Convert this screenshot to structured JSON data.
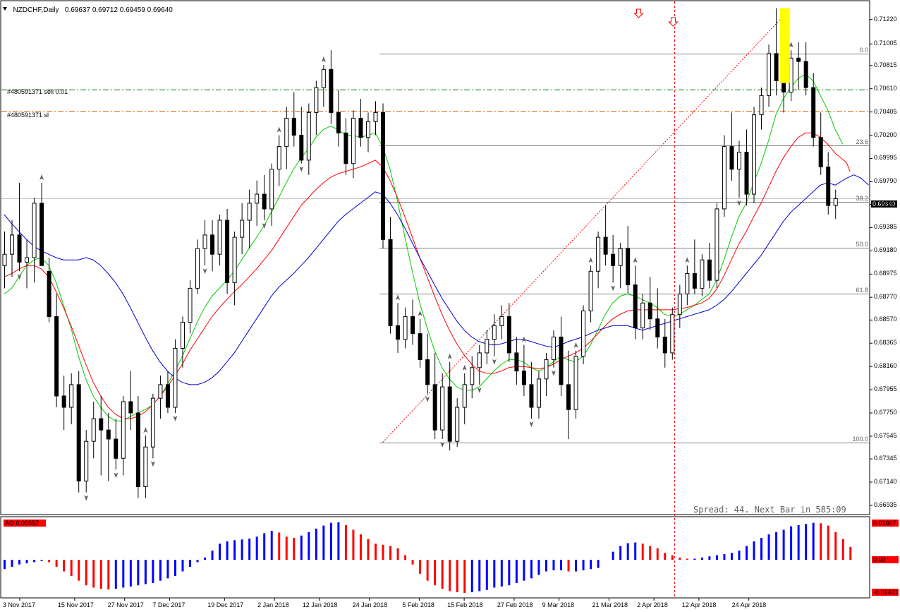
{
  "header": {
    "symbol": "NZDCHF,Daily",
    "ohlc": "0.69637 0.69712 0.69459 0.69640"
  },
  "orders": {
    "sell_label": "#480591371 sell 0.01",
    "sl_label": "#480591371 sl"
  },
  "spread_text": "Spread: 44. Next Bar in 585:09",
  "indicator": {
    "name": "AO 0.00557",
    "max_label": "0.01607",
    "zero_label": "0.00",
    "min_label": "-0.01431"
  },
  "price_axis": [
    "0.71220",
    "0.71005",
    "0.70815",
    "0.70610",
    "0.70405",
    "0.70200",
    "0.69995",
    "0.69790",
    "0.69590",
    "0.69385",
    "0.69180",
    "0.68975",
    "0.68770",
    "0.68570",
    "0.68365",
    "0.68160",
    "0.67955",
    "0.67750",
    "0.67545",
    "0.67345",
    "0.67140",
    "0.66935"
  ],
  "current_price": "0.69640",
  "fib_levels": [
    {
      "label": "0.0",
      "price": 0.7092
    },
    {
      "label": "23.6",
      "price": 0.7011
    },
    {
      "label": "38.2",
      "price": 0.6961
    },
    {
      "label": "50.0",
      "price": 0.6921
    },
    {
      "label": "61.8",
      "price": 0.688
    },
    {
      "label": "100.0",
      "price": 0.6749
    }
  ],
  "time_axis": [
    "3 Nov 2017",
    "15 Nov 2017",
    "27 Nov 2017",
    "7 Dec 2017",
    "19 Dec 2017",
    "2 Jan 2018",
    "12 Jan 2018",
    "24 Jan 2018",
    "5 Feb 2018",
    "15 Feb 2018",
    "27 Feb 2018",
    "9 Mar 2018",
    "21 Mar 2018",
    "2 Apr 2018",
    "12 Apr 2018",
    "24 Apr 2018"
  ],
  "colors": {
    "bull": "#ffffff",
    "bear": "#000000",
    "ma_fast": "#00cc00",
    "ma_mid": "#ff0000",
    "ma_slow": "#0000cc",
    "ao_up": "#0000ff",
    "ao_down": "#ff0000",
    "order_line": "#008000",
    "sl_line": "#e05a00",
    "highlight": "#ffff00"
  },
  "chart_data": {
    "type": "candlestick",
    "title": "NZDCHF,Daily",
    "ylim": [
      0.6686,
      0.7138
    ],
    "candles": [
      [
        0.6905,
        0.6935,
        0.6885,
        0.6915
      ],
      [
        0.6915,
        0.6945,
        0.6895,
        0.6932
      ],
      [
        0.6932,
        0.6978,
        0.69,
        0.6908
      ],
      [
        0.6908,
        0.6928,
        0.6885,
        0.6912
      ],
      [
        0.6912,
        0.6965,
        0.689,
        0.696
      ],
      [
        0.696,
        0.6978,
        0.692,
        0.6905
      ],
      [
        0.69,
        0.6912,
        0.6855,
        0.686
      ],
      [
        0.686,
        0.688,
        0.678,
        0.679
      ],
      [
        0.679,
        0.6808,
        0.676,
        0.678
      ],
      [
        0.678,
        0.681,
        0.6765,
        0.68
      ],
      [
        0.68,
        0.6812,
        0.6705,
        0.6715
      ],
      [
        0.6715,
        0.676,
        0.6705,
        0.675
      ],
      [
        0.675,
        0.6785,
        0.6735,
        0.677
      ],
      [
        0.677,
        0.679,
        0.672,
        0.676
      ],
      [
        0.676,
        0.6775,
        0.6715,
        0.6752
      ],
      [
        0.6752,
        0.677,
        0.6725,
        0.6735
      ],
      [
        0.6735,
        0.679,
        0.672,
        0.6785
      ],
      [
        0.6785,
        0.6812,
        0.676,
        0.6775
      ],
      [
        0.6775,
        0.679,
        0.67,
        0.671
      ],
      [
        0.671,
        0.6755,
        0.67,
        0.6745
      ],
      [
        0.6745,
        0.6792,
        0.6735,
        0.6788
      ],
      [
        0.6788,
        0.6808,
        0.677,
        0.68
      ],
      [
        0.68,
        0.6812,
        0.6775,
        0.678
      ],
      [
        0.678,
        0.684,
        0.6775,
        0.6832
      ],
      [
        0.6832,
        0.686,
        0.6815,
        0.6855
      ],
      [
        0.6855,
        0.6892,
        0.6845,
        0.6885
      ],
      [
        0.6885,
        0.6928,
        0.688,
        0.692
      ],
      [
        0.692,
        0.6945,
        0.6905,
        0.6932
      ],
      [
        0.6932,
        0.6945,
        0.69,
        0.6915
      ],
      [
        0.6915,
        0.695,
        0.6905,
        0.6945
      ],
      [
        0.6945,
        0.6955,
        0.688,
        0.689
      ],
      [
        0.689,
        0.6935,
        0.687,
        0.693
      ],
      [
        0.693,
        0.696,
        0.6915,
        0.6945
      ],
      [
        0.6945,
        0.6972,
        0.692,
        0.696
      ],
      [
        0.696,
        0.698,
        0.694,
        0.6968
      ],
      [
        0.6968,
        0.6985,
        0.6945,
        0.6955
      ],
      [
        0.6955,
        0.6995,
        0.694,
        0.699
      ],
      [
        0.699,
        0.702,
        0.6975,
        0.701
      ],
      [
        0.701,
        0.7045,
        0.699,
        0.7035
      ],
      [
        0.7035,
        0.7058,
        0.701,
        0.702
      ],
      [
        0.702,
        0.7045,
        0.6995,
        0.6998
      ],
      [
        0.6998,
        0.7048,
        0.6985,
        0.704
      ],
      [
        0.704,
        0.7068,
        0.702,
        0.7062
      ],
      [
        0.7062,
        0.7082,
        0.7045,
        0.7078
      ],
      [
        0.7078,
        0.7095,
        0.703,
        0.704
      ],
      [
        0.704,
        0.706,
        0.701,
        0.7022
      ],
      [
        0.7022,
        0.7035,
        0.6985,
        0.6995
      ],
      [
        0.6995,
        0.7042,
        0.6982,
        0.7035
      ],
      [
        0.7035,
        0.7052,
        0.701,
        0.7018
      ],
      [
        0.7018,
        0.704,
        0.7005,
        0.7032
      ],
      [
        0.7032,
        0.705,
        0.702,
        0.704
      ],
      [
        0.704,
        0.7048,
        0.692,
        0.6928
      ],
      [
        0.6928,
        0.6948,
        0.6845,
        0.6852
      ],
      [
        0.6852,
        0.6872,
        0.6828,
        0.684
      ],
      [
        0.684,
        0.6868,
        0.6832,
        0.686
      ],
      [
        0.686,
        0.6875,
        0.6835,
        0.6845
      ],
      [
        0.6845,
        0.6858,
        0.6815,
        0.6822
      ],
      [
        0.6822,
        0.6845,
        0.6792,
        0.68
      ],
      [
        0.68,
        0.6828,
        0.6752,
        0.676
      ],
      [
        0.676,
        0.681,
        0.6752,
        0.6798
      ],
      [
        0.6798,
        0.682,
        0.6742,
        0.675
      ],
      [
        0.675,
        0.6788,
        0.6745,
        0.678
      ],
      [
        0.678,
        0.681,
        0.6765,
        0.68
      ],
      [
        0.68,
        0.6825,
        0.6788,
        0.6815
      ],
      [
        0.6815,
        0.6835,
        0.68,
        0.6828
      ],
      [
        0.6828,
        0.6848,
        0.6818,
        0.684
      ],
      [
        0.684,
        0.6862,
        0.6825,
        0.6852
      ],
      [
        0.6852,
        0.687,
        0.684,
        0.686
      ],
      [
        0.686,
        0.6872,
        0.682,
        0.6828
      ],
      [
        0.6828,
        0.6842,
        0.68,
        0.6812
      ],
      [
        0.6812,
        0.6835,
        0.679,
        0.68
      ],
      [
        0.68,
        0.682,
        0.677,
        0.678
      ],
      [
        0.678,
        0.6812,
        0.677,
        0.6805
      ],
      [
        0.6805,
        0.6828,
        0.679,
        0.6822
      ],
      [
        0.6822,
        0.6848,
        0.6815,
        0.6842
      ],
      [
        0.6842,
        0.686,
        0.679,
        0.68
      ],
      [
        0.68,
        0.683,
        0.6752,
        0.6778
      ],
      [
        0.6778,
        0.683,
        0.677,
        0.6825
      ],
      [
        0.6825,
        0.687,
        0.6818,
        0.6865
      ],
      [
        0.6865,
        0.6905,
        0.6855,
        0.69
      ],
      [
        0.69,
        0.6935,
        0.6885,
        0.693
      ],
      [
        0.693,
        0.6958,
        0.6905,
        0.6915
      ],
      [
        0.6915,
        0.6932,
        0.689,
        0.6905
      ],
      [
        0.6905,
        0.6925,
        0.6885,
        0.692
      ],
      [
        0.692,
        0.694,
        0.688,
        0.6888
      ],
      [
        0.6888,
        0.6905,
        0.684,
        0.685
      ],
      [
        0.685,
        0.688,
        0.684,
        0.6872
      ],
      [
        0.6872,
        0.6895,
        0.6848,
        0.6858
      ],
      [
        0.6858,
        0.6885,
        0.6832,
        0.6842
      ],
      [
        0.6842,
        0.6858,
        0.6815,
        0.6828
      ],
      [
        0.6828,
        0.6868,
        0.6822,
        0.6862
      ],
      [
        0.6862,
        0.6888,
        0.685,
        0.688
      ],
      [
        0.688,
        0.6905,
        0.687,
        0.6898
      ],
      [
        0.6898,
        0.6928,
        0.688,
        0.6885
      ],
      [
        0.6885,
        0.6915,
        0.6878,
        0.691
      ],
      [
        0.691,
        0.6925,
        0.6885,
        0.6892
      ],
      [
        0.6892,
        0.696,
        0.6885,
        0.6955
      ],
      [
        0.6955,
        0.702,
        0.6948,
        0.701
      ],
      [
        0.701,
        0.704,
        0.698,
        0.699
      ],
      [
        0.699,
        0.7015,
        0.6965,
        0.7005
      ],
      [
        0.7005,
        0.7025,
        0.6958,
        0.6968
      ],
      [
        0.6968,
        0.7045,
        0.696,
        0.7038
      ],
      [
        0.7038,
        0.7062,
        0.7025,
        0.7055
      ],
      [
        0.7055,
        0.71,
        0.7045,
        0.7092
      ],
      [
        0.7092,
        0.7132,
        0.7055,
        0.7068
      ],
      [
        0.7068,
        0.7085,
        0.704,
        0.7058
      ],
      [
        0.7058,
        0.7095,
        0.705,
        0.7088
      ],
      [
        0.7088,
        0.7102,
        0.706,
        0.7085
      ],
      [
        0.7085,
        0.7102,
        0.7055,
        0.7062
      ],
      [
        0.7062,
        0.7075,
        0.701,
        0.7018
      ],
      [
        0.7018,
        0.704,
        0.6985,
        0.6992
      ],
      [
        0.6992,
        0.7005,
        0.695,
        0.6958
      ],
      [
        0.6958,
        0.6972,
        0.6946,
        0.6964
      ]
    ],
    "ma_fast": [
      0.688,
      0.6885,
      0.6895,
      0.6905,
      0.691,
      0.6912,
      0.6905,
      0.689,
      0.687,
      0.685,
      0.6825,
      0.6805,
      0.679,
      0.678,
      0.6772,
      0.6768,
      0.6768,
      0.6772,
      0.6775,
      0.6778,
      0.6782,
      0.679,
      0.68,
      0.6812,
      0.6825,
      0.684,
      0.6855,
      0.6868,
      0.6878,
      0.6885,
      0.6892,
      0.69,
      0.691,
      0.692,
      0.693,
      0.694,
      0.6952,
      0.6965,
      0.6978,
      0.699,
      0.7,
      0.7008,
      0.7018,
      0.7025,
      0.7028,
      0.7025,
      0.702,
      0.702,
      0.7018,
      0.702,
      0.7022,
      0.701,
      0.699,
      0.6962,
      0.693,
      0.69,
      0.6872,
      0.685,
      0.683,
      0.6815,
      0.6805,
      0.6798,
      0.6795,
      0.6795,
      0.6798,
      0.6805,
      0.6812,
      0.6818,
      0.6822,
      0.6822,
      0.682,
      0.6815,
      0.6812,
      0.6815,
      0.682,
      0.6825,
      0.6822,
      0.682,
      0.6825,
      0.6835,
      0.6848,
      0.6862,
      0.6872,
      0.6878,
      0.688,
      0.6878,
      0.6875,
      0.6872,
      0.6868,
      0.6862,
      0.686,
      0.6862,
      0.6866,
      0.687,
      0.6875,
      0.688,
      0.6892,
      0.691,
      0.693,
      0.6948,
      0.696,
      0.6978,
      0.6995,
      0.7015,
      0.7038,
      0.7052,
      0.7062,
      0.707,
      0.7074,
      0.7068,
      0.7055,
      0.7042,
      0.7025
    ],
    "ma_mid": [
      0.6895,
      0.6898,
      0.6902,
      0.6905,
      0.6905,
      0.6902,
      0.6895,
      0.6882,
      0.6868,
      0.6852,
      0.6835,
      0.6818,
      0.6802,
      0.679,
      0.678,
      0.6774,
      0.677,
      0.677,
      0.6772,
      0.6776,
      0.6782,
      0.679,
      0.6798,
      0.6808,
      0.6818,
      0.683,
      0.684,
      0.685,
      0.686,
      0.6868,
      0.6875,
      0.6882,
      0.6888,
      0.6895,
      0.6902,
      0.691,
      0.6918,
      0.6928,
      0.6938,
      0.6948,
      0.6958,
      0.6965,
      0.6972,
      0.6978,
      0.6983,
      0.6986,
      0.6988,
      0.699,
      0.6992,
      0.6995,
      0.6998,
      0.6992,
      0.698,
      0.6965,
      0.6948,
      0.693,
      0.6912,
      0.6895,
      0.6878,
      0.6862,
      0.6848,
      0.6836,
      0.6826,
      0.6818,
      0.6812,
      0.681,
      0.681,
      0.6812,
      0.6815,
      0.6816,
      0.6816,
      0.6815,
      0.6814,
      0.6815,
      0.6818,
      0.6822,
      0.6825,
      0.6828,
      0.6832,
      0.6838,
      0.6845,
      0.6852,
      0.6858,
      0.6862,
      0.6865,
      0.6866,
      0.6866,
      0.6866,
      0.6866,
      0.6866,
      0.6866,
      0.6867,
      0.6868,
      0.687,
      0.6872,
      0.6876,
      0.6884,
      0.6896,
      0.691,
      0.6924,
      0.6935,
      0.6948,
      0.696,
      0.6974,
      0.6988,
      0.7,
      0.701,
      0.7018,
      0.7022,
      0.7022,
      0.7018,
      0.7012,
      0.7004
    ],
    "ma_slow": [
      0.695,
      0.6942,
      0.6935,
      0.6928,
      0.6922,
      0.6918,
      0.6915,
      0.6912,
      0.691,
      0.691,
      0.691,
      0.6912,
      0.691,
      0.6905,
      0.6898,
      0.689,
      0.688,
      0.6868,
      0.6855,
      0.6842,
      0.683,
      0.682,
      0.6812,
      0.6806,
      0.6802,
      0.68,
      0.68,
      0.6802,
      0.6806,
      0.6812,
      0.682,
      0.6828,
      0.6838,
      0.6848,
      0.6858,
      0.6868,
      0.6878,
      0.6886,
      0.6892,
      0.6898,
      0.6905,
      0.6912,
      0.692,
      0.6928,
      0.6936,
      0.6944,
      0.695,
      0.6955,
      0.696,
      0.6965,
      0.697,
      0.6968,
      0.696,
      0.695,
      0.6938,
      0.6925,
      0.6912,
      0.69,
      0.6888,
      0.6876,
      0.6866,
      0.6856,
      0.6848,
      0.6842,
      0.6838,
      0.6836,
      0.6835,
      0.6836,
      0.6838,
      0.684,
      0.684,
      0.6838,
      0.6836,
      0.6834,
      0.6833,
      0.6835,
      0.6838,
      0.684,
      0.6842,
      0.6845,
      0.6848,
      0.685,
      0.6852,
      0.6852,
      0.6852,
      0.685,
      0.6848,
      0.685,
      0.6852,
      0.6854,
      0.6856,
      0.6858,
      0.686,
      0.6862,
      0.6864,
      0.6866,
      0.687,
      0.6875,
      0.6882,
      0.689,
      0.6898,
      0.6906,
      0.6914,
      0.6924,
      0.6934,
      0.6944,
      0.6952,
      0.6958,
      0.6964,
      0.697,
      0.6976,
      0.6978,
      0.6976
    ],
    "ao": [
      -0.004,
      -0.003,
      -0.002,
      -0.0015,
      -0.001,
      -0.0005,
      -0.001,
      -0.003,
      -0.005,
      -0.007,
      -0.009,
      -0.011,
      -0.012,
      -0.0125,
      -0.0128,
      -0.0125,
      -0.012,
      -0.0115,
      -0.011,
      -0.0105,
      -0.01,
      -0.009,
      -0.008,
      -0.007,
      -0.005,
      -0.003,
      -0.001,
      0.001,
      0.004,
      0.007,
      0.008,
      0.0085,
      0.0088,
      0.0092,
      0.01,
      0.0115,
      0.0125,
      0.0118,
      0.01,
      0.0095,
      0.0105,
      0.012,
      0.0135,
      0.0148,
      0.016,
      0.0162,
      0.015,
      0.013,
      0.011,
      0.009,
      0.007,
      0.0065,
      0.006,
      0.005,
      0.002,
      -0.002,
      -0.006,
      -0.009,
      -0.011,
      -0.0125,
      -0.0135,
      -0.014,
      -0.0143,
      -0.014,
      -0.0135,
      -0.013,
      -0.012,
      -0.0115,
      -0.011,
      -0.01,
      -0.009,
      -0.008,
      -0.0065,
      -0.005,
      -0.0045,
      -0.0045,
      -0.005,
      -0.005,
      -0.0045,
      -0.004,
      -0.0035,
      0.0,
      0.0035,
      0.006,
      0.0072,
      0.0075,
      0.007,
      0.006,
      0.005,
      0.003,
      0.002,
      0.001,
      0.0005,
      0.0005,
      0.001,
      0.0015,
      0.002,
      0.0025,
      0.003,
      0.004,
      0.006,
      0.008,
      0.0095,
      0.011,
      0.012,
      0.013,
      0.0145,
      0.015,
      0.0155,
      0.016,
      0.0158,
      0.0148,
      0.012,
      0.009,
      0.0056
    ],
    "up_fractals": [
      5,
      19,
      37,
      43,
      53,
      56,
      60,
      62,
      70,
      77,
      79,
      85,
      92,
      106
    ],
    "down_fractals": [
      2,
      11,
      15,
      20,
      23,
      27,
      35,
      40,
      57,
      59,
      64,
      66,
      71,
      74,
      82,
      99
    ]
  }
}
